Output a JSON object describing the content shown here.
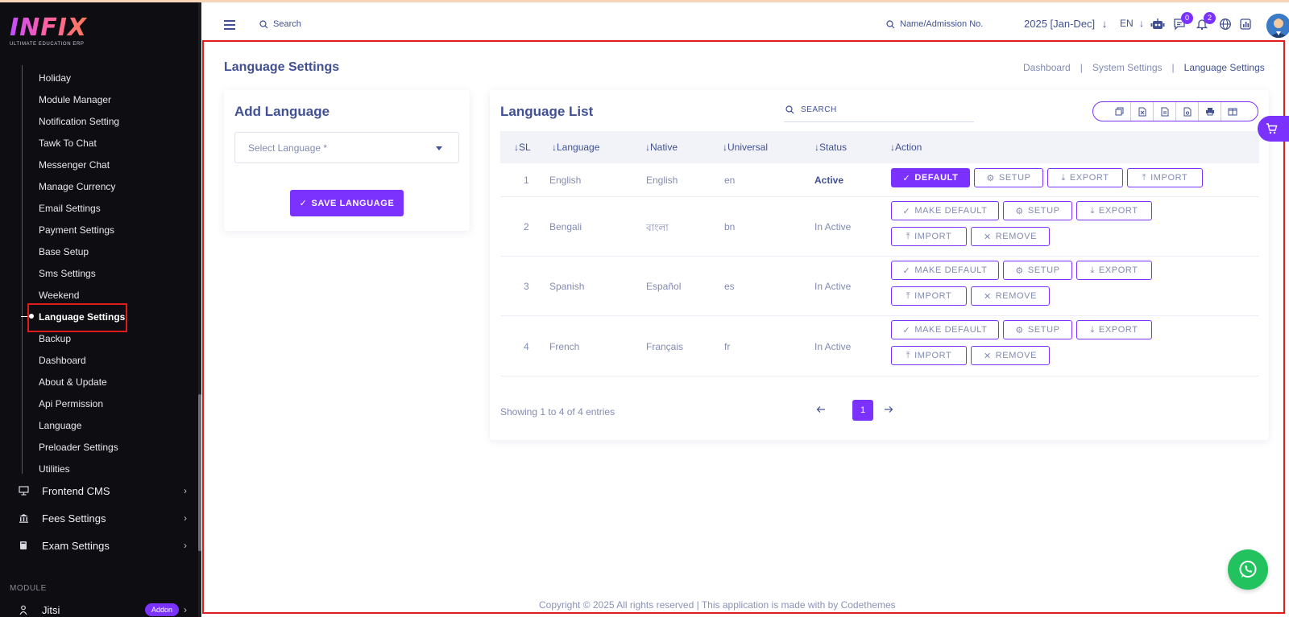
{
  "brand": {
    "logo": "INFIX",
    "tagline": "ULTIMATE EDUCATION ERP"
  },
  "sidebar": {
    "sub_items": [
      {
        "label": "Holiday"
      },
      {
        "label": "Module Manager"
      },
      {
        "label": "Notification Setting"
      },
      {
        "label": "Tawk To Chat"
      },
      {
        "label": "Messenger Chat"
      },
      {
        "label": "Manage Currency"
      },
      {
        "label": "Email Settings"
      },
      {
        "label": "Payment Settings"
      },
      {
        "label": "Base Setup"
      },
      {
        "label": "Sms Settings"
      },
      {
        "label": "Weekend"
      },
      {
        "label": "Language Settings",
        "active": true
      },
      {
        "label": "Backup"
      },
      {
        "label": "Dashboard"
      },
      {
        "label": "About & Update"
      },
      {
        "label": "Api Permission"
      },
      {
        "label": "Language"
      },
      {
        "label": "Preloader Settings"
      },
      {
        "label": "Utilities"
      }
    ],
    "main_items": [
      {
        "label": "Frontend CMS",
        "icon": "monitor-icon"
      },
      {
        "label": "Fees Settings",
        "icon": "bank-icon"
      },
      {
        "label": "Exam Settings",
        "icon": "book-icon"
      }
    ],
    "section_label": "MODULE",
    "module_item": {
      "label": "Jitsi",
      "badge": "Addon",
      "icon": "jitsi-icon"
    }
  },
  "topbar": {
    "search_label": "Search",
    "student_search_label": "Name/Admission No.",
    "academic_year": "2025 [Jan-Dec]",
    "language": "EN",
    "message_count": "0",
    "notification_count": "2"
  },
  "page": {
    "title": "Language Settings",
    "breadcrumb": [
      "Dashboard",
      "System Settings",
      "Language Settings"
    ]
  },
  "add_language": {
    "title": "Add Language",
    "select_placeholder": "Select Language *",
    "save_label": "SAVE LANGUAGE"
  },
  "language_list": {
    "title": "Language List",
    "search_placeholder": "SEARCH",
    "columns": [
      "SL",
      "Language",
      "Native",
      "Universal",
      "Status",
      "Action"
    ],
    "rows": [
      {
        "sl": "1",
        "language": "English",
        "native": "English",
        "universal": "en",
        "status": "Active",
        "is_default": true
      },
      {
        "sl": "2",
        "language": "Bengali",
        "native": "বাংলা",
        "universal": "bn",
        "status": "In Active",
        "is_default": false
      },
      {
        "sl": "3",
        "language": "Spanish",
        "native": "Español",
        "universal": "es",
        "status": "In Active",
        "is_default": false
      },
      {
        "sl": "4",
        "language": "French",
        "native": "Français",
        "universal": "fr",
        "status": "In Active",
        "is_default": false
      }
    ],
    "actions": {
      "default": "DEFAULT",
      "make_default": "MAKE DEFAULT",
      "setup": "SETUP",
      "export": "EXPORT",
      "import": "IMPORT",
      "remove": "REMOVE"
    },
    "showing_text": "Showing 1 to 4 of 4 entries",
    "current_page": "1"
  },
  "footer": {
    "copyright": "Copyright © 2025 All rights reserved | This application is made with by Codethemes"
  },
  "colors": {
    "accent": "#7c32ff",
    "text": "#415094",
    "muted": "#828bb2",
    "sidebar_bg": "#0d0d12",
    "whatsapp": "#22c35e",
    "highlight": "#e01b1b"
  }
}
